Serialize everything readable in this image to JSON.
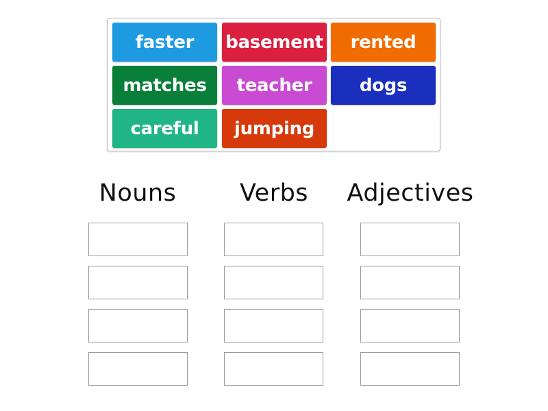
{
  "word_bank": {
    "tiles": [
      {
        "word": "faster",
        "color": "#1e9be0"
      },
      {
        "word": "basement",
        "color": "#db1f3e"
      },
      {
        "word": "rented",
        "color": "#f06c00"
      },
      {
        "word": "matches",
        "color": "#0a7f3a"
      },
      {
        "word": "teacher",
        "color": "#c84bd2"
      },
      {
        "word": "dogs",
        "color": "#1a2fbd"
      },
      {
        "word": "careful",
        "color": "#1fb585"
      },
      {
        "word": "jumping",
        "color": "#d63a0a"
      }
    ]
  },
  "categories": [
    {
      "title": "Nouns",
      "slots": 4
    },
    {
      "title": "Verbs",
      "slots": 4
    },
    {
      "title": "Adjectives",
      "slots": 4
    }
  ]
}
